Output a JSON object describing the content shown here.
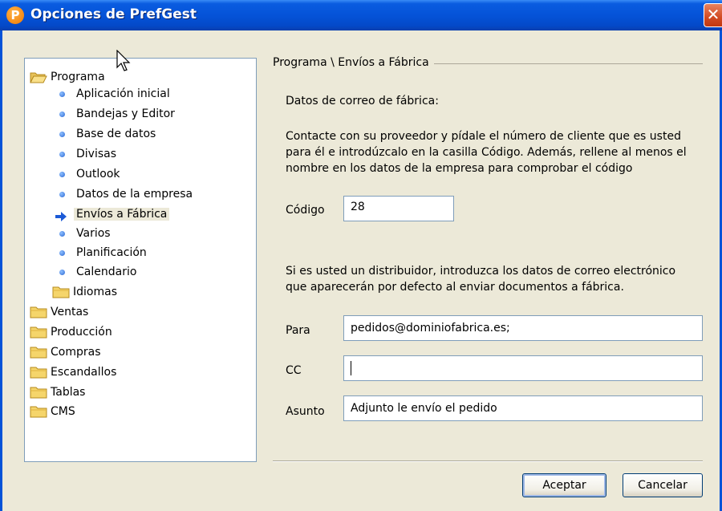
{
  "window": {
    "title": "Opciones de PrefGest",
    "icon_letter": "P",
    "close_glyph": "✕"
  },
  "tree": {
    "items": [
      {
        "label": "Programa",
        "type": "folder-open",
        "level": 0
      },
      {
        "label": "Aplicación inicial",
        "type": "leaf",
        "level": 1
      },
      {
        "label": "Bandejas y Editor",
        "type": "leaf",
        "level": 1
      },
      {
        "label": "Base de datos",
        "type": "leaf",
        "level": 1
      },
      {
        "label": "Divisas",
        "type": "leaf",
        "level": 1
      },
      {
        "label": "Outlook",
        "type": "leaf",
        "level": 1
      },
      {
        "label": "Datos de la empresa",
        "type": "leaf",
        "level": 1
      },
      {
        "label": "Envíos a Fábrica",
        "type": "selected",
        "level": 1
      },
      {
        "label": "Varios",
        "type": "leaf",
        "level": 1
      },
      {
        "label": "Planificación",
        "type": "leaf",
        "level": 1
      },
      {
        "label": "Calendario",
        "type": "leaf",
        "level": 1
      },
      {
        "label": "Idiomas",
        "type": "folder",
        "level": 1
      },
      {
        "label": "Ventas",
        "type": "folder",
        "level": 0
      },
      {
        "label": "Producción",
        "type": "folder",
        "level": 0
      },
      {
        "label": "Compras",
        "type": "folder",
        "level": 0
      },
      {
        "label": "Escandallos",
        "type": "folder",
        "level": 0
      },
      {
        "label": "Tablas",
        "type": "folder",
        "level": 0
      },
      {
        "label": "CMS",
        "type": "folder",
        "level": 0
      }
    ]
  },
  "panel": {
    "section_title": "Programa \\ Envíos a Fábrica",
    "heading": "Datos de correo de fábrica:",
    "intro_lines": [
      "Contacte con su proveedor y pídale el número de cliente que es usted",
      "para él e introdúzcalo en la casilla Código. Además, rellene al menos el",
      "nombre en los datos de la empresa para comprobar el código"
    ],
    "codigo_label": "Código",
    "codigo_value": "28",
    "distrib_lines": [
      "Si es usted un distribuidor, introduzca los datos de correo electrónico",
      "que aparecerán por defecto al enviar documentos a fábrica."
    ],
    "para_label": "Para",
    "para_value": "pedidos@dominiofabrica.es;",
    "cc_label": "CC",
    "cc_value": "",
    "asunto_label": "Asunto",
    "asunto_value": "Adjunto le envío el pedido"
  },
  "buttons": {
    "accept": "Aceptar",
    "cancel": "Cancelar"
  },
  "colors": {
    "titlebar": "#0553d8",
    "dialog_bg": "#ece9d8",
    "bullet": "#2c69d4",
    "selected_arrow": "#1c5ad6"
  }
}
